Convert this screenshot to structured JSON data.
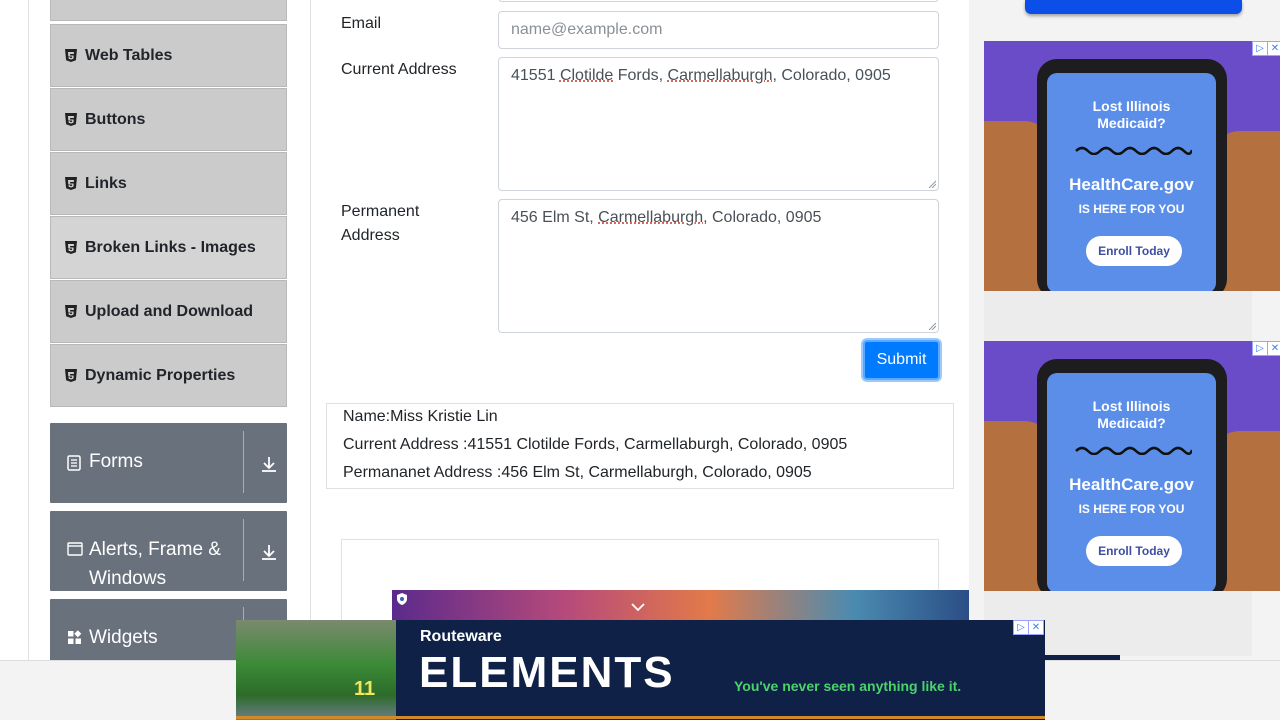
{
  "sidebar": {
    "elements_items": [
      {
        "label": ""
      },
      {
        "label": "Web Tables"
      },
      {
        "label": "Buttons"
      },
      {
        "label": "Links"
      },
      {
        "label": "Broken Links - Images"
      },
      {
        "label": "Upload and Download"
      },
      {
        "label": "Dynamic Properties"
      }
    ],
    "groups": [
      {
        "label": "Forms",
        "icon": "document-icon"
      },
      {
        "label": "Alerts, Frame &",
        "label2": "Windows",
        "icon": "window-icon"
      },
      {
        "label": "Widgets",
        "icon": "widgets-icon"
      }
    ]
  },
  "form": {
    "email_label": "Email",
    "email_placeholder": "name@example.com",
    "current_address_label": "Current Address",
    "current_address_value": {
      "part1": "41551 ",
      "part2": "Clotilde",
      "part3": " Fords, ",
      "part4": "Carmellaburgh",
      "part5": ", Colorado, 0905"
    },
    "permanent_address_label": "Permanent",
    "permanent_address_label2": "Address",
    "permanent_address_value": {
      "part1": "456 Elm St, ",
      "part2": "Carmellaburgh",
      "part3": ", Colorado, 0905"
    },
    "submit_label": "Submit"
  },
  "output": {
    "name": "Name:Miss Kristie Lin",
    "current_address": "Current Address :41551 Clotilde Fords, Carmellaburgh, Colorado, 0905",
    "permanent_address": "Permananet Address :456 Elm St, Carmellaburgh, Colorado, 0905"
  },
  "ads": {
    "healthcare": {
      "headline1": "Lost Illinois",
      "headline2": "Medicaid?",
      "brand": "HealthCare.gov",
      "sub": "IS HERE FOR YOU",
      "cta": "Enroll Today"
    },
    "banner": {
      "company": "Routeware",
      "product": "ELEMENTS",
      "tagline": "You've never seen anything like it.",
      "number": "11"
    },
    "ad_choices_glyph": "▷",
    "close_glyph": "✕"
  },
  "colors": {
    "primary_button": "#007bff",
    "group_header": "#68717c",
    "menu_item": "#cbcbcb"
  }
}
